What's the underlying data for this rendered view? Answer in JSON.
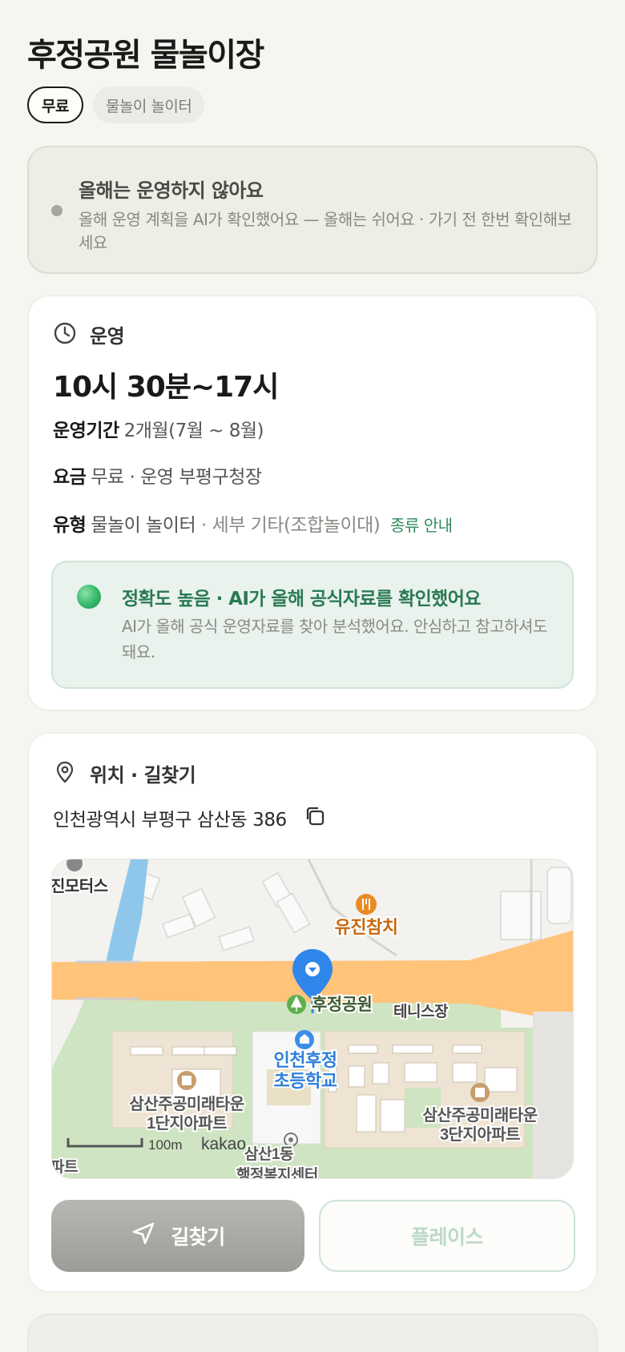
{
  "header": {
    "title": "후정공원 물놀이장",
    "chips": [
      "무료",
      "물놀이 놀이터"
    ]
  },
  "notice": {
    "title": "올해는 운영하지 않아요",
    "description": "올해 운영 계획을 AI가 확인했어요 — 올해는 쉬어요 · 가기 전 한번 확인해보세요"
  },
  "hours": {
    "section_label": "운영",
    "time_range": "10시 30분~17시",
    "period_label": "운영기간",
    "period_value": "2개월(7월 ~ 8월)",
    "fee_label": "요금",
    "fee_value": "무료 · 운영 부평구청장",
    "type_label": "유형",
    "type_value": "물놀이 놀이터",
    "type_sub": "· 세부 기타(조합놀이대)",
    "type_link": "종류 안내",
    "accuracy_title": "정확도 높음 · AI가 올해 공식자료를 확인했어요",
    "accuracy_desc": "AI가 올해 공식 운영자료를 찾아 분석했어요. 안심하고 참고하셔도 돼요."
  },
  "location": {
    "section_label": "위치 · 길찾기",
    "address": "인천광역시 부평구 삼산동 386",
    "map": {
      "labels": {
        "restaurant": "유진참치",
        "park": "후정공원",
        "tennis": "테니스장",
        "school_line1": "인천후정",
        "school_line2": "초등학교",
        "apt1_line1": "삼산주공미래타운",
        "apt1_line2": "1단지아파트",
        "apt3_line1": "삼산주공미래타운",
        "apt3_line2": "3단지아파트",
        "motors": "진모터스",
        "office": "삼산1동",
        "office_line2": "행정복지센터",
        "edge_left": "파트",
        "scale": "100m",
        "brand": "kakao"
      }
    },
    "nav_button": "길찾기",
    "place_button": "플레이스"
  },
  "colors": {
    "accent_green": "#2f8a5b",
    "road_orange": "#ffc37a",
    "pin_blue": "#2f86eb"
  }
}
